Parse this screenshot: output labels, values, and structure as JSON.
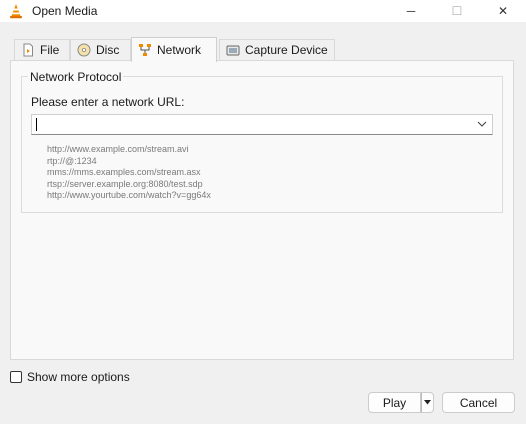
{
  "window": {
    "title": "Open Media",
    "controls": {
      "minimize": "─",
      "maximize": "☐",
      "close": "✕"
    }
  },
  "tabs": [
    {
      "label": "File",
      "icon": "file-icon",
      "active": false
    },
    {
      "label": "Disc",
      "icon": "disc-icon",
      "active": false
    },
    {
      "label": "Network",
      "icon": "network-icon",
      "active": true
    },
    {
      "label": "Capture Device",
      "icon": "capture-device-icon",
      "active": false
    }
  ],
  "network": {
    "group_title": "Network Protocol",
    "url_label": "Please enter a network URL:",
    "url_value": "",
    "examples": [
      "http://www.example.com/stream.avi",
      "rtp://@:1234",
      "mms://mms.examples.com/stream.asx",
      "rtsp://server.example.org:8080/test.sdp",
      "http://www.yourtube.com/watch?v=gg64x"
    ]
  },
  "options": {
    "show_more_label": "Show more options",
    "checked": false
  },
  "buttons": {
    "play": "Play",
    "cancel": "Cancel"
  },
  "colors": {
    "vlc_orange": "#f28a00",
    "active_tab_bg": "#f9f9f9",
    "dialog_bg": "#f0f0f0"
  }
}
